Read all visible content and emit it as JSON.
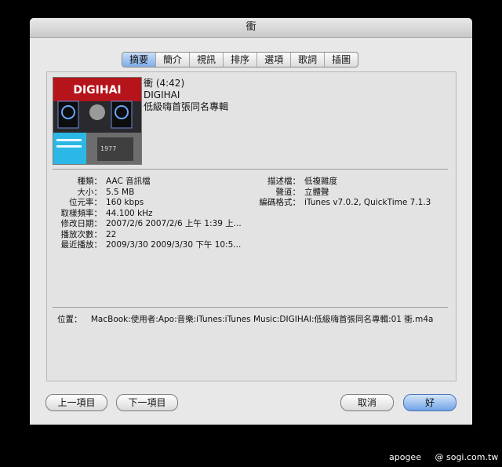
{
  "window": {
    "title": "衝"
  },
  "tabs": [
    "摘要",
    "簡介",
    "視訊",
    "排序",
    "選項",
    "歌詞",
    "插圖"
  ],
  "active_tab": "摘要",
  "album_art": {
    "text": "DIGIHAI",
    "number": "1977"
  },
  "song": {
    "title_line": "衝 (4:42)",
    "artist": "DIGIHAI",
    "album": "低級嗨首張同名專輯"
  },
  "info_left": [
    {
      "label": "種類：",
      "value": "AAC 音訊檔"
    },
    {
      "label": "大小：",
      "value": "5.5 MB"
    },
    {
      "label": "位元率：",
      "value": "160 kbps"
    },
    {
      "label": "取樣頻率：",
      "value": "44.100 kHz"
    },
    {
      "label": "修改日期：",
      "value": "2007/2/6 2007/2/6 上午 1:39 上..."
    },
    {
      "label": "播放次數：",
      "value": "22"
    },
    {
      "label": "最近播放：",
      "value": "2009/3/30 2009/3/30 下午 10:5..."
    }
  ],
  "info_right": [
    {
      "label": "描述檔：",
      "value": "低複雜度"
    },
    {
      "label": "聲道：",
      "value": "立體聲"
    },
    {
      "label": "編碼格式：",
      "value": "iTunes v7.0.2, QuickTime 7.1.3"
    }
  ],
  "location": {
    "label": "位置：",
    "value": "MacBook:使用者:Apo:音樂:iTunes:iTunes Music:DIGIHAI:低級嗨首張同名專輯:01 衝.m4a"
  },
  "buttons": {
    "previous": "上一項目",
    "next": "下一項目",
    "cancel": "取消",
    "ok": "好"
  },
  "credit": {
    "author": "apogee",
    "site": "@ sogi.com.tw"
  }
}
